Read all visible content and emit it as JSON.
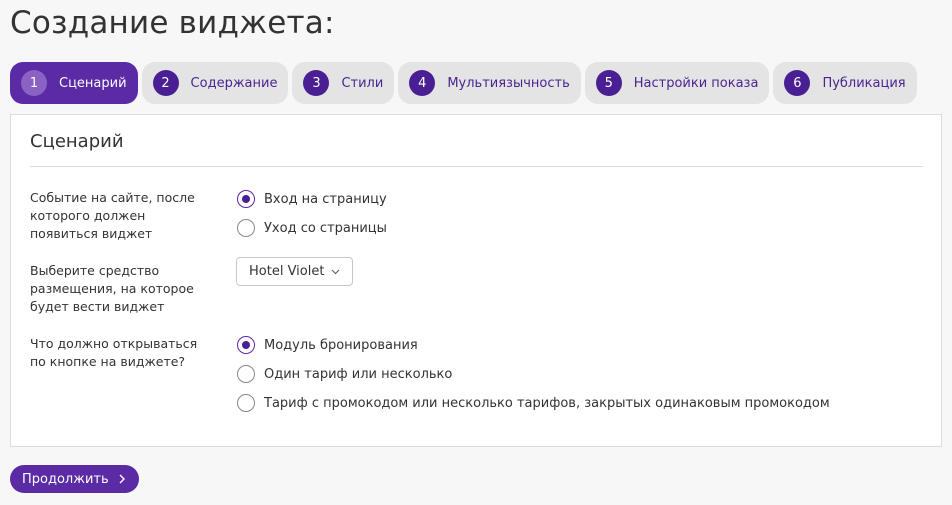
{
  "page": {
    "title": "Создание виджета:"
  },
  "steps": [
    {
      "num": "1",
      "label": "Сценарий",
      "active": true
    },
    {
      "num": "2",
      "label": "Содержание",
      "active": false
    },
    {
      "num": "3",
      "label": "Стили",
      "active": false
    },
    {
      "num": "4",
      "label": "Мультиязычность",
      "active": false
    },
    {
      "num": "5",
      "label": "Настройки показа",
      "active": false
    },
    {
      "num": "6",
      "label": "Публикация",
      "active": false
    }
  ],
  "panel": {
    "title": "Сценарий",
    "event": {
      "label": "Событие на сайте, после которого должен появиться виджет",
      "options": [
        {
          "label": "Вход на страницу",
          "checked": true
        },
        {
          "label": "Уход со страницы",
          "checked": false
        }
      ]
    },
    "property": {
      "label": "Выберите средство размещения, на которое будет вести виджет",
      "selected": "Hotel Violet"
    },
    "opens": {
      "label": "Что должно открываться по кнопке на виджете?",
      "options": [
        {
          "label": "Модуль бронирования",
          "checked": true
        },
        {
          "label": "Один тариф или несколько",
          "checked": false
        },
        {
          "label": "Тариф с промокодом или несколько тарифов, закрытых одинаковым промокодом",
          "checked": false
        }
      ]
    }
  },
  "footer": {
    "continue_label": "Продолжить"
  },
  "icons": {
    "select_chevron": "chevron-down-icon",
    "continue_arrow": "chevron-right-icon"
  },
  "colors": {
    "accent": "#5b2aa5",
    "step_inactive_bg": "#e4e4e4",
    "step_number_bg": "#4a1f93"
  }
}
